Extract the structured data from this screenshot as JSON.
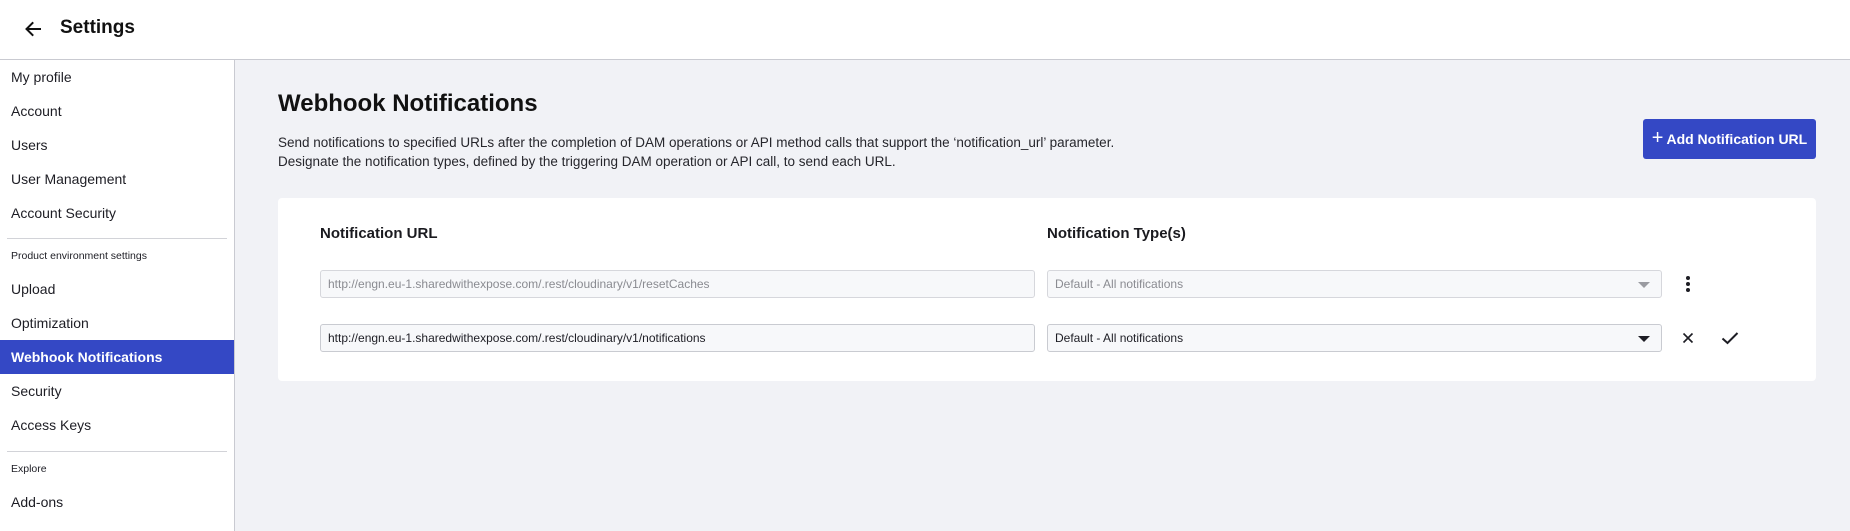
{
  "header": {
    "title": "Settings",
    "back_icon": "arrow-left-icon"
  },
  "sidebar": {
    "items": [
      {
        "label": "My profile"
      },
      {
        "label": "Account"
      },
      {
        "label": "Users"
      },
      {
        "label": "User Management"
      },
      {
        "label": "Account Security"
      }
    ],
    "product_section_label": "Product environment settings",
    "product_items": [
      {
        "label": "Upload"
      },
      {
        "label": "Optimization"
      },
      {
        "label": "Webhook Notifications",
        "active": true
      },
      {
        "label": "Security"
      },
      {
        "label": "Access Keys"
      }
    ],
    "explore_section_label": "Explore",
    "explore_items": [
      {
        "label": "Add-ons"
      }
    ]
  },
  "main": {
    "title": "Webhook Notifications",
    "description": "Send notifications to specified URLs after the completion of DAM operations or API method calls that support the ‘notification_url’ parameter. Designate the notification types, defined by the triggering DAM operation or API call, to send each URL.",
    "add_button_label": "Add Notification URL",
    "add_button_icon": "plus-icon",
    "table": {
      "url_column_label": "Notification URL",
      "type_column_label": "Notification Type(s)",
      "rows": [
        {
          "url": "http://engn.eu-1.sharedwithexpose.com/.rest/cloudinary/v1/resetCaches",
          "type": "Default - All notifications",
          "state": "saved"
        },
        {
          "url": "http://engn.eu-1.sharedwithexpose.com/.rest/cloudinary/v1/notifications",
          "type": "Default - All notifications",
          "state": "editing"
        }
      ]
    }
  },
  "colors": {
    "accent": "#3448c5",
    "page_background": "#f1f2f6",
    "surface": "#ffffff"
  }
}
